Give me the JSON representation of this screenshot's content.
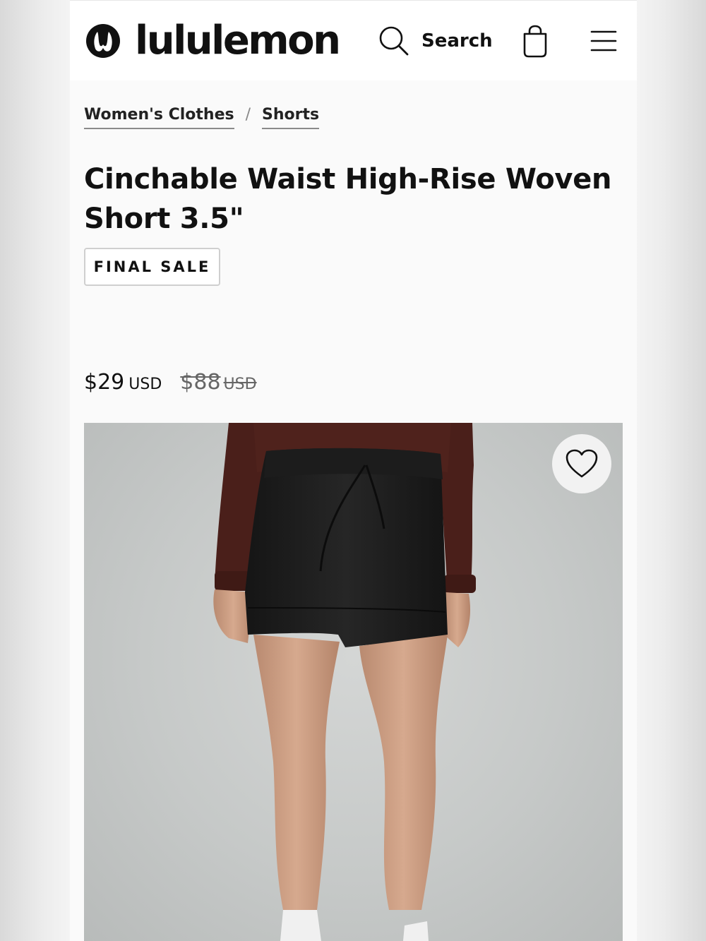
{
  "header": {
    "brand": "lululemon",
    "logo_icon": "lululemon-logo-icon",
    "search_label": "Search",
    "search_icon": "search-icon",
    "bag_icon": "shopping-bag-icon",
    "menu_icon": "hamburger-menu-icon"
  },
  "breadcrumb": {
    "items": [
      {
        "label": "Women's Clothes"
      },
      {
        "label": "Shorts"
      }
    ],
    "separator": "/"
  },
  "product": {
    "title": "Cinchable Waist High-Rise Woven Short 3.5\"",
    "badge": "FINAL SALE",
    "price": {
      "current": "$29",
      "current_currency": "USD",
      "original": "$88",
      "original_currency": "USD"
    },
    "wishlist_icon": "heart-icon"
  },
  "colors": {
    "text": "#111111",
    "page_background": "#fafafa",
    "header_background": "#ffffff",
    "strikethrough_price": "#666666",
    "image_background": "#c6c9c8"
  }
}
